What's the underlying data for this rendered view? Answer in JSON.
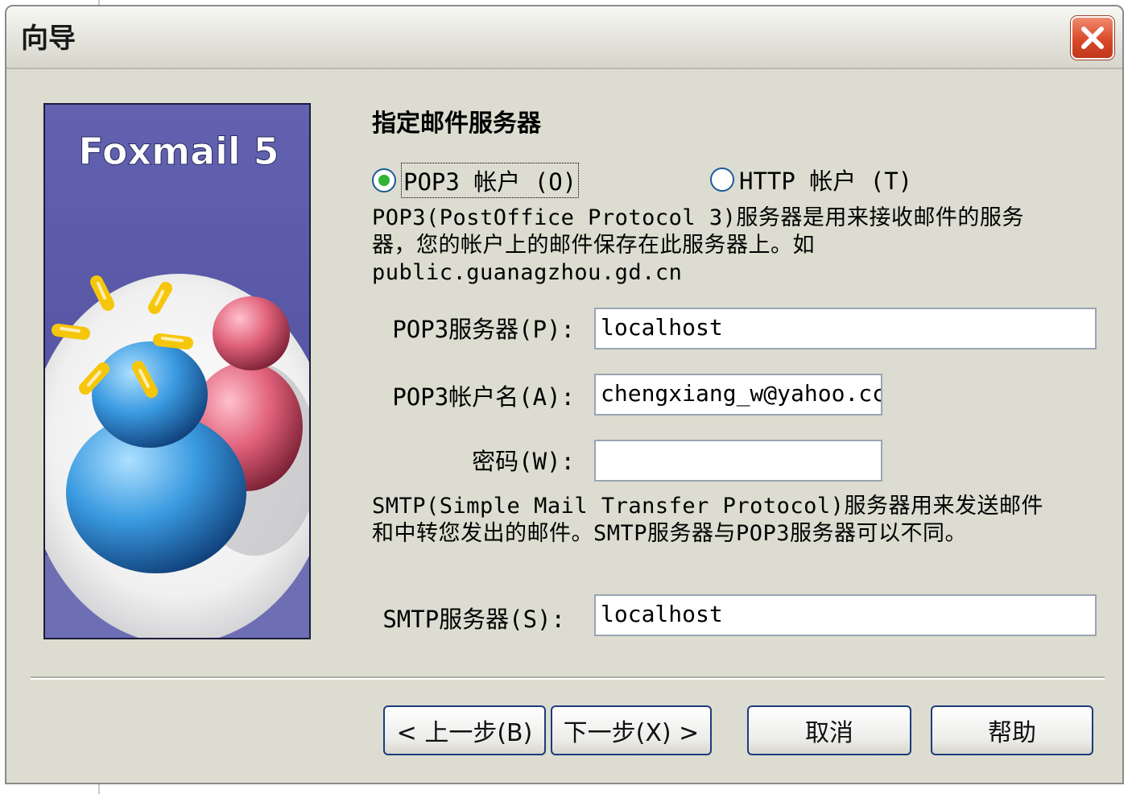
{
  "window": {
    "title": "向导"
  },
  "banner": {
    "logo_text": "Foxmail 5"
  },
  "page": {
    "heading": "指定邮件服务器",
    "account_type": {
      "pop3_label": "POP3 帐户 (O)",
      "http_label": "HTTP 帐户 (T)",
      "selected": "pop3"
    },
    "pop3_description": "POP3(PostOffice Protocol 3)服务器是用来接收邮件的服务\n器，您的帐户上的邮件保存在此服务器上。如\npublic.guanagzhou.gd.cn",
    "fields": {
      "pop3_server": {
        "label": "POP3服务器(P):",
        "value": "localhost"
      },
      "pop3_account": {
        "label": "POP3帐户名(A):",
        "value": "chengxiang_w@yahoo.cc"
      },
      "password": {
        "label": "密码(W):",
        "value": ""
      }
    },
    "smtp_description": "SMTP(Simple Mail Transfer Protocol)服务器用来发送邮件\n和中转您发出的邮件。SMTP服务器与POP3服务器可以不同。",
    "smtp_server": {
      "label": "SMTP服务器(S):",
      "value": "localhost"
    }
  },
  "buttons": {
    "back": "< 上一步(B)",
    "next": "下一步(X) >",
    "cancel": "取消",
    "help": "帮助"
  },
  "colors": {
    "banner_top": "#5a5aa8",
    "banner_bottom": "#6e6eb4",
    "person_blue": "#3a9ae0",
    "person_pink": "#e0607a",
    "spark_yellow": "#f6c60a",
    "close_red": "#d94a2a"
  }
}
